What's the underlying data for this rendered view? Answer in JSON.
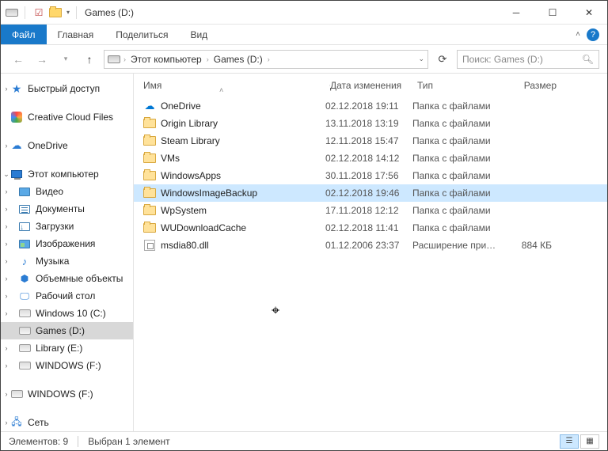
{
  "window": {
    "title": "Games (D:)"
  },
  "ribbon": {
    "file": "Файл",
    "home": "Главная",
    "share": "Поделиться",
    "view": "Вид"
  },
  "breadcrumb": {
    "pc": "Этот компьютер",
    "drive": "Games (D:)"
  },
  "search": {
    "placeholder": "Поиск: Games (D:)"
  },
  "nav": {
    "quick": "Быстрый доступ",
    "cc": "Creative Cloud Files",
    "onedrive": "OneDrive",
    "pc": "Этот компьютер",
    "video": "Видео",
    "documents": "Документы",
    "downloads": "Загрузки",
    "pictures": "Изображения",
    "music": "Музыка",
    "objects3d": "Объемные объекты",
    "desktop": "Рабочий стол",
    "drive_c": "Windows 10 (C:)",
    "drive_d": "Games (D:)",
    "drive_e": "Library (E:)",
    "drive_f": "WINDOWS (F:)",
    "drive_f2": "WINDOWS (F:)",
    "network": "Сеть"
  },
  "columns": {
    "name": "Имя",
    "date": "Дата изменения",
    "type": "Тип",
    "size": "Размер"
  },
  "files": [
    {
      "icon": "cloud",
      "name": "OneDrive",
      "date": "02.12.2018 19:11",
      "type": "Папка с файлами",
      "size": "",
      "selected": false
    },
    {
      "icon": "folder",
      "name": "Origin Library",
      "date": "13.11.2018 13:19",
      "type": "Папка с файлами",
      "size": "",
      "selected": false
    },
    {
      "icon": "folder",
      "name": "Steam Library",
      "date": "12.11.2018 15:47",
      "type": "Папка с файлами",
      "size": "",
      "selected": false
    },
    {
      "icon": "folder",
      "name": "VMs",
      "date": "02.12.2018 14:12",
      "type": "Папка с файлами",
      "size": "",
      "selected": false
    },
    {
      "icon": "folder",
      "name": "WindowsApps",
      "date": "30.11.2018 17:56",
      "type": "Папка с файлами",
      "size": "",
      "selected": false
    },
    {
      "icon": "folder",
      "name": "WindowsImageBackup",
      "date": "02.12.2018 19:46",
      "type": "Папка с файлами",
      "size": "",
      "selected": true
    },
    {
      "icon": "folder",
      "name": "WpSystem",
      "date": "17.11.2018 12:12",
      "type": "Папка с файлами",
      "size": "",
      "selected": false
    },
    {
      "icon": "folder",
      "name": "WUDownloadCache",
      "date": "02.12.2018 11:41",
      "type": "Папка с файлами",
      "size": "",
      "selected": false
    },
    {
      "icon": "dll",
      "name": "msdia80.dll",
      "date": "01.12.2006 23:37",
      "type": "Расширение при…",
      "size": "884 КБ",
      "selected": false
    }
  ],
  "status": {
    "count": "Элементов: 9",
    "selection": "Выбран 1 элемент"
  }
}
